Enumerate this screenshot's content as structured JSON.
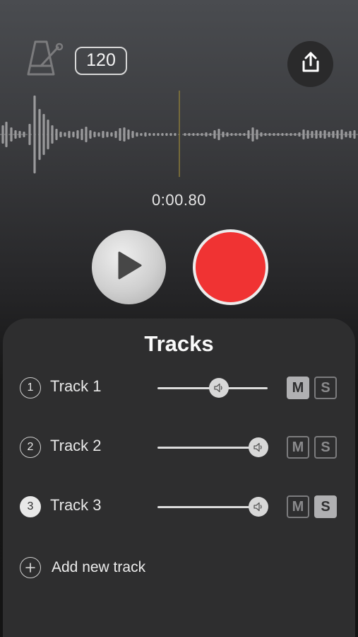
{
  "header": {
    "tempo": "120",
    "metronome_icon": "metronome-icon",
    "share_icon": "share-icon"
  },
  "playback": {
    "time": "0:00.80",
    "play_icon": "play-icon"
  },
  "tracks_panel": {
    "title": "Tracks",
    "tracks": [
      {
        "number": "1",
        "name": "Track 1",
        "volume": 0.56,
        "mute": "M",
        "solo": "S",
        "mute_on": true,
        "solo_on": false,
        "selected": false
      },
      {
        "number": "2",
        "name": "Track 2",
        "volume": 0.97,
        "mute": "M",
        "solo": "S",
        "mute_on": false,
        "solo_on": false,
        "selected": false
      },
      {
        "number": "3",
        "name": "Track 3",
        "volume": 0.97,
        "mute": "M",
        "solo": "S",
        "mute_on": false,
        "solo_on": true,
        "selected": true
      }
    ],
    "add_track": "Add new track"
  },
  "colors": {
    "record": "#f03333",
    "playhead": "#8a7a3a",
    "panel": "#2e2e2f"
  }
}
